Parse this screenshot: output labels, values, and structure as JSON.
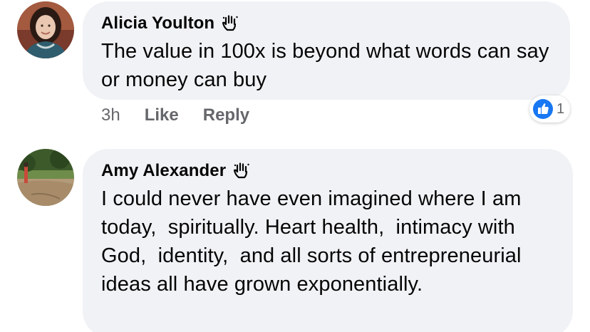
{
  "comments": [
    {
      "author": "Alicia Youlton",
      "badge_icon": "raised-hand-icon",
      "text": "The value in 100x is beyond what words can say or money can buy",
      "timestamp": "3h",
      "like_label": "Like",
      "reply_label": "Reply",
      "reaction": {
        "icon": "like-thumb-icon",
        "count": "1",
        "color": "#1877f2"
      }
    },
    {
      "author": "Amy Alexander",
      "badge_icon": "raised-hand-icon",
      "text": "I could never have even imagined where I am today,  spiritually. Heart health,  intimacy with God,  identity,  and all sorts of entrepreneurial ideas all have grown exponentially."
    }
  ],
  "colors": {
    "bubble": "#f0f2f5",
    "meta_text": "#65676b",
    "like_blue": "#1877f2"
  }
}
